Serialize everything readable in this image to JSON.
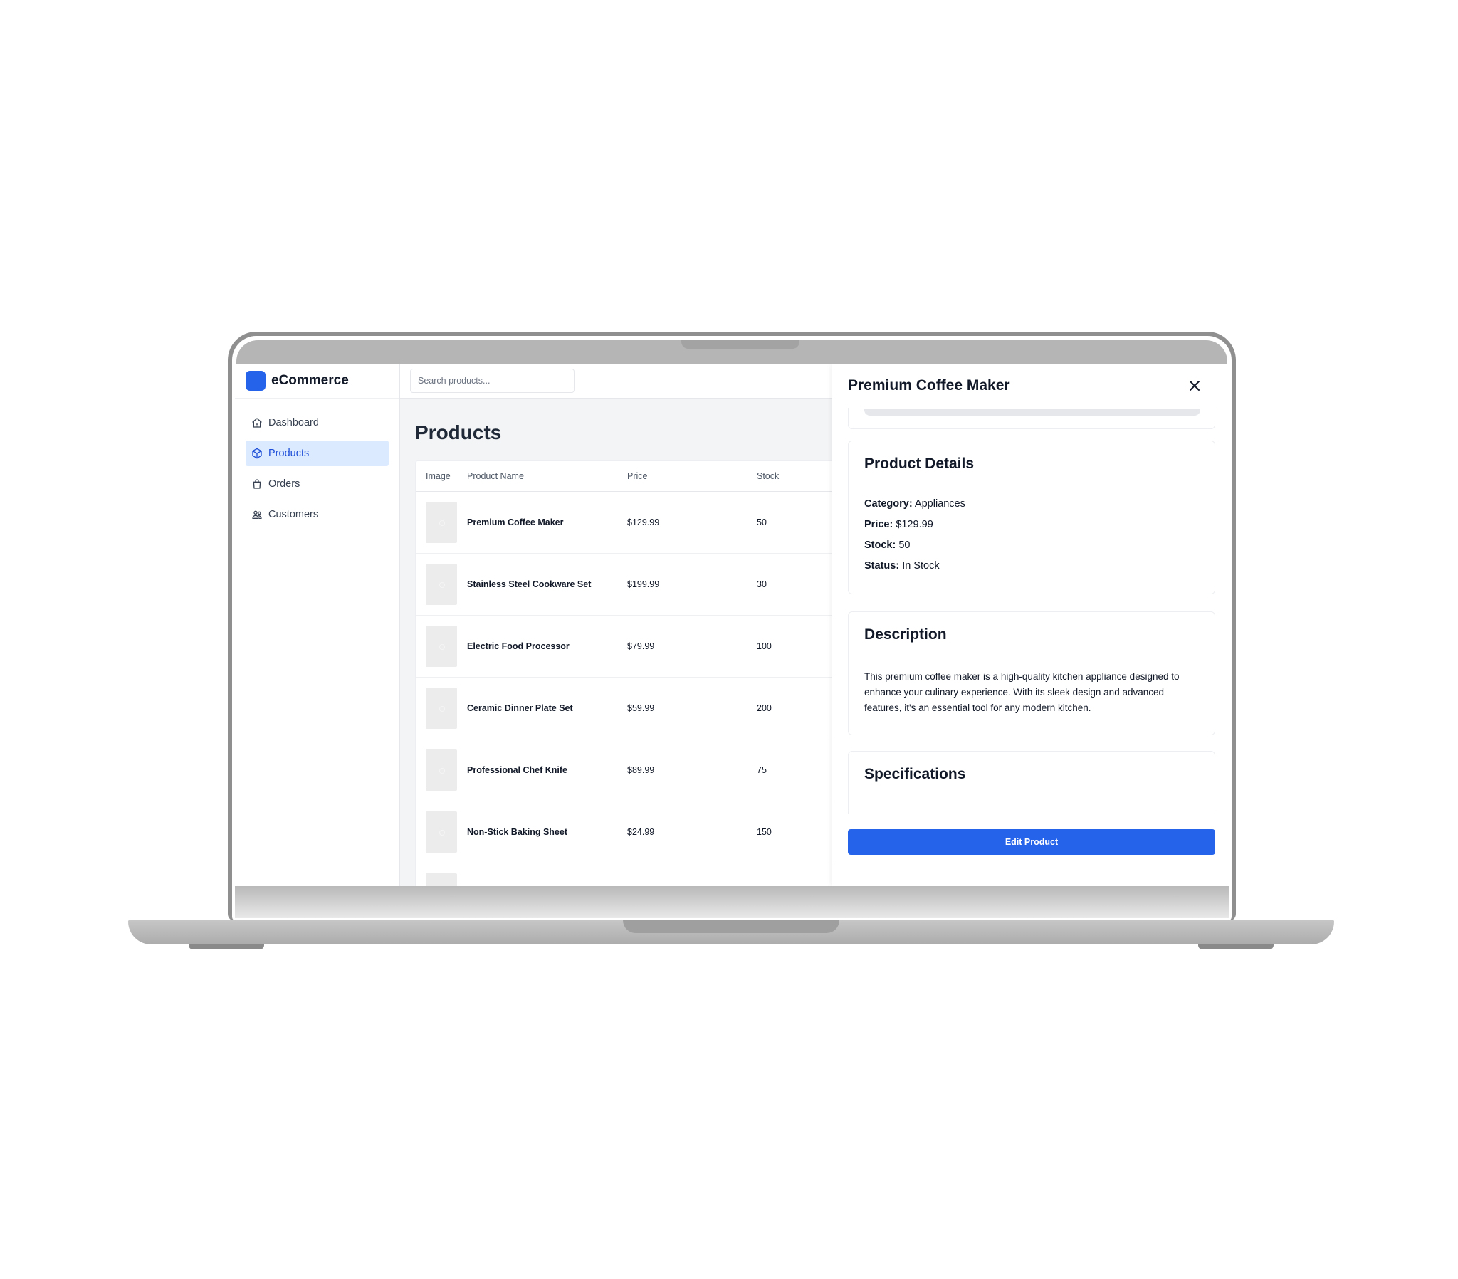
{
  "brand": {
    "name": "eCommerce",
    "logo_color": "#2563eb"
  },
  "search": {
    "placeholder": "Search products..."
  },
  "sidebar": {
    "items": [
      {
        "label": "Dashboard",
        "icon": "home-icon",
        "active": false
      },
      {
        "label": "Products",
        "icon": "box-icon",
        "active": true
      },
      {
        "label": "Orders",
        "icon": "shopping-bag-icon",
        "active": false
      },
      {
        "label": "Customers",
        "icon": "users-icon",
        "active": false
      }
    ]
  },
  "main": {
    "title": "Products",
    "table": {
      "columns": [
        "Image",
        "Product Name",
        "Price",
        "Stock"
      ],
      "rows": [
        {
          "name": "Premium Coffee Maker",
          "price": "$129.99",
          "stock": "50"
        },
        {
          "name": "Stainless Steel Cookware Set",
          "price": "$199.99",
          "stock": "30"
        },
        {
          "name": "Electric Food Processor",
          "price": "$79.99",
          "stock": "100"
        },
        {
          "name": "Ceramic Dinner Plate Set",
          "price": "$59.99",
          "stock": "200"
        },
        {
          "name": "Professional Chef Knife",
          "price": "$89.99",
          "stock": "75"
        },
        {
          "name": "Non-Stick Baking Sheet",
          "price": "$24.99",
          "stock": "150"
        },
        {
          "name": "",
          "price": "",
          "stock": ""
        }
      ]
    }
  },
  "panel": {
    "title": "Premium Coffee Maker",
    "close_icon": "close-icon",
    "details": {
      "title": "Product Details",
      "category_label": "Category:",
      "category_value": "Appliances",
      "price_label": "Price:",
      "price_value": "$129.99",
      "stock_label": "Stock:",
      "stock_value": "50",
      "status_label": "Status:",
      "status_value": "In Stock"
    },
    "description": {
      "title": "Description",
      "text": "This premium coffee maker is a high-quality kitchen appliance designed to enhance your culinary experience. With its sleek design and advanced features, it's an essential tool for any modern kitchen."
    },
    "specifications": {
      "title": "Specifications"
    },
    "edit_label": "Edit Product",
    "accent_color": "#2563eb"
  }
}
